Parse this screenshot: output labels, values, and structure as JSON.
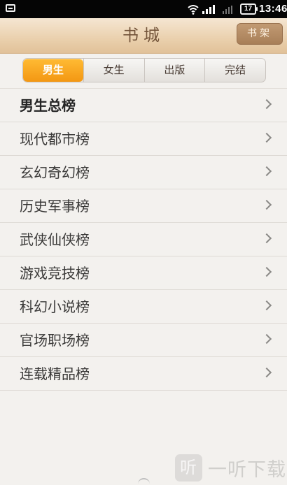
{
  "status_bar": {
    "time": "13:46",
    "battery": "17",
    "icons": [
      "notification-icon",
      "wifi-icon",
      "signal-icon",
      "signal-icon-secondary",
      "battery-icon"
    ]
  },
  "header": {
    "title": "书城",
    "bookshelf_label": "书架"
  },
  "tabs": [
    {
      "label": "男生",
      "active": true
    },
    {
      "label": "女生",
      "active": false
    },
    {
      "label": "出版",
      "active": false
    },
    {
      "label": "完结",
      "active": false
    }
  ],
  "rankings": [
    {
      "label": "男生总榜",
      "bold": true
    },
    {
      "label": "现代都市榜"
    },
    {
      "label": "玄幻奇幻榜"
    },
    {
      "label": "历史军事榜"
    },
    {
      "label": "武侠仙侠榜"
    },
    {
      "label": "游戏竞技榜"
    },
    {
      "label": "科幻小说榜"
    },
    {
      "label": "官场职场榜"
    },
    {
      "label": "连载精品榜"
    }
  ],
  "watermark": {
    "logo_text": "听",
    "text": "一听下载"
  },
  "colors": {
    "active_tab": "#f39713",
    "header_title": "#73543a",
    "bookshelf_button": "#a87f58",
    "background": "#f3f1ee"
  }
}
